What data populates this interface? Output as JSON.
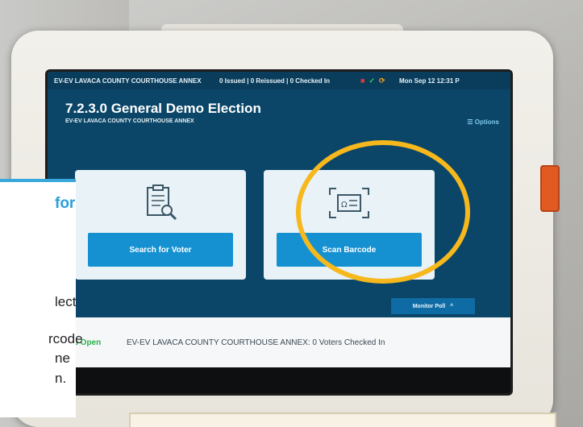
{
  "status_bar": {
    "location": "EV-EV LAVACA COUNTY COURTHOUSE ANNEX",
    "counts": "0 Issued | 0 Reissued | 0 Checked In",
    "datetime": "Mon Sep 12  12:31 P"
  },
  "header": {
    "title": "7.2.3.0 General Demo Election",
    "subtitle": "EV-EV LAVACA COUNTY COURTHOUSE ANNEX",
    "options_label": "☰ Options"
  },
  "cards": {
    "search_label": "Search for Voter",
    "scan_label": "Scan Barcode"
  },
  "monitor_poll": {
    "label": "Monitor Poll",
    "caret": "^"
  },
  "footer": {
    "polls_status": "Polls Open",
    "summary": "EV-EV LAVACA COUNTY COURTHOUSE ANNEX: 0 Voters Checked In"
  },
  "overlay": {
    "heading": "for",
    "line1": "lect",
    "line2": "rcode",
    "line3": "ne",
    "line4": "n."
  },
  "colors": {
    "screen_bg": "#0b4668",
    "button_blue": "#1591d2",
    "highlight_circle": "#f6b81c",
    "polls_open_green": "#2bb24c",
    "accent_orange": "#e05a21"
  },
  "icons": [
    "printer-icon",
    "check-icon",
    "sync-icon",
    "clipboard-search-icon",
    "id-card-scan-icon",
    "options-menu-icon"
  ]
}
